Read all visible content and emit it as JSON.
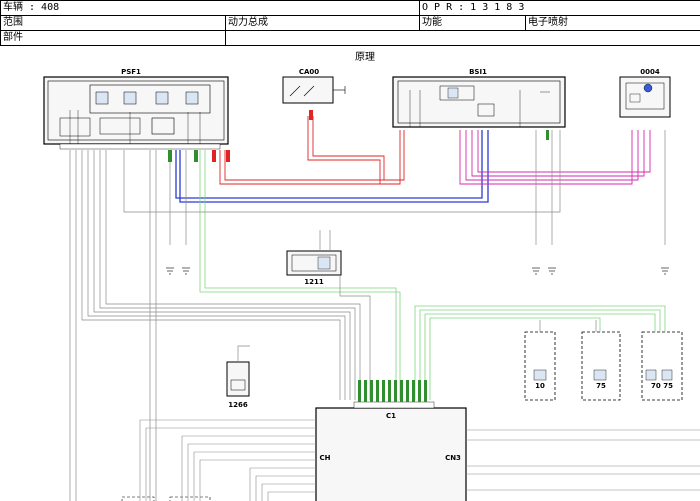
{
  "header": {
    "vehicle_label": "车辆 : 408",
    "opr_label": "O P R : 1 3 1 8 3",
    "range_key": "范围",
    "range_value": "动力总成",
    "function_key": "功能",
    "function_value": "电子喷射",
    "part_key": "部件",
    "part_value": ""
  },
  "caption": "原理",
  "components": {
    "psf1": "PSF1",
    "ca00": "CA00",
    "bsi1": "BSI1",
    "c0004": "0004",
    "c1211": "1211",
    "c1266": "1266",
    "ecu": "C1",
    "ecu_left": "CH",
    "ecu_right": "CN3",
    "box1": "10",
    "box2": "75",
    "box3": "70 75"
  },
  "colors": {
    "black": "#1a1a1a",
    "red": "#e02424",
    "blue": "#2a3bd6",
    "magenta": "#d62ab0",
    "green": "#7fd67f",
    "gray": "#9a9a9a"
  }
}
